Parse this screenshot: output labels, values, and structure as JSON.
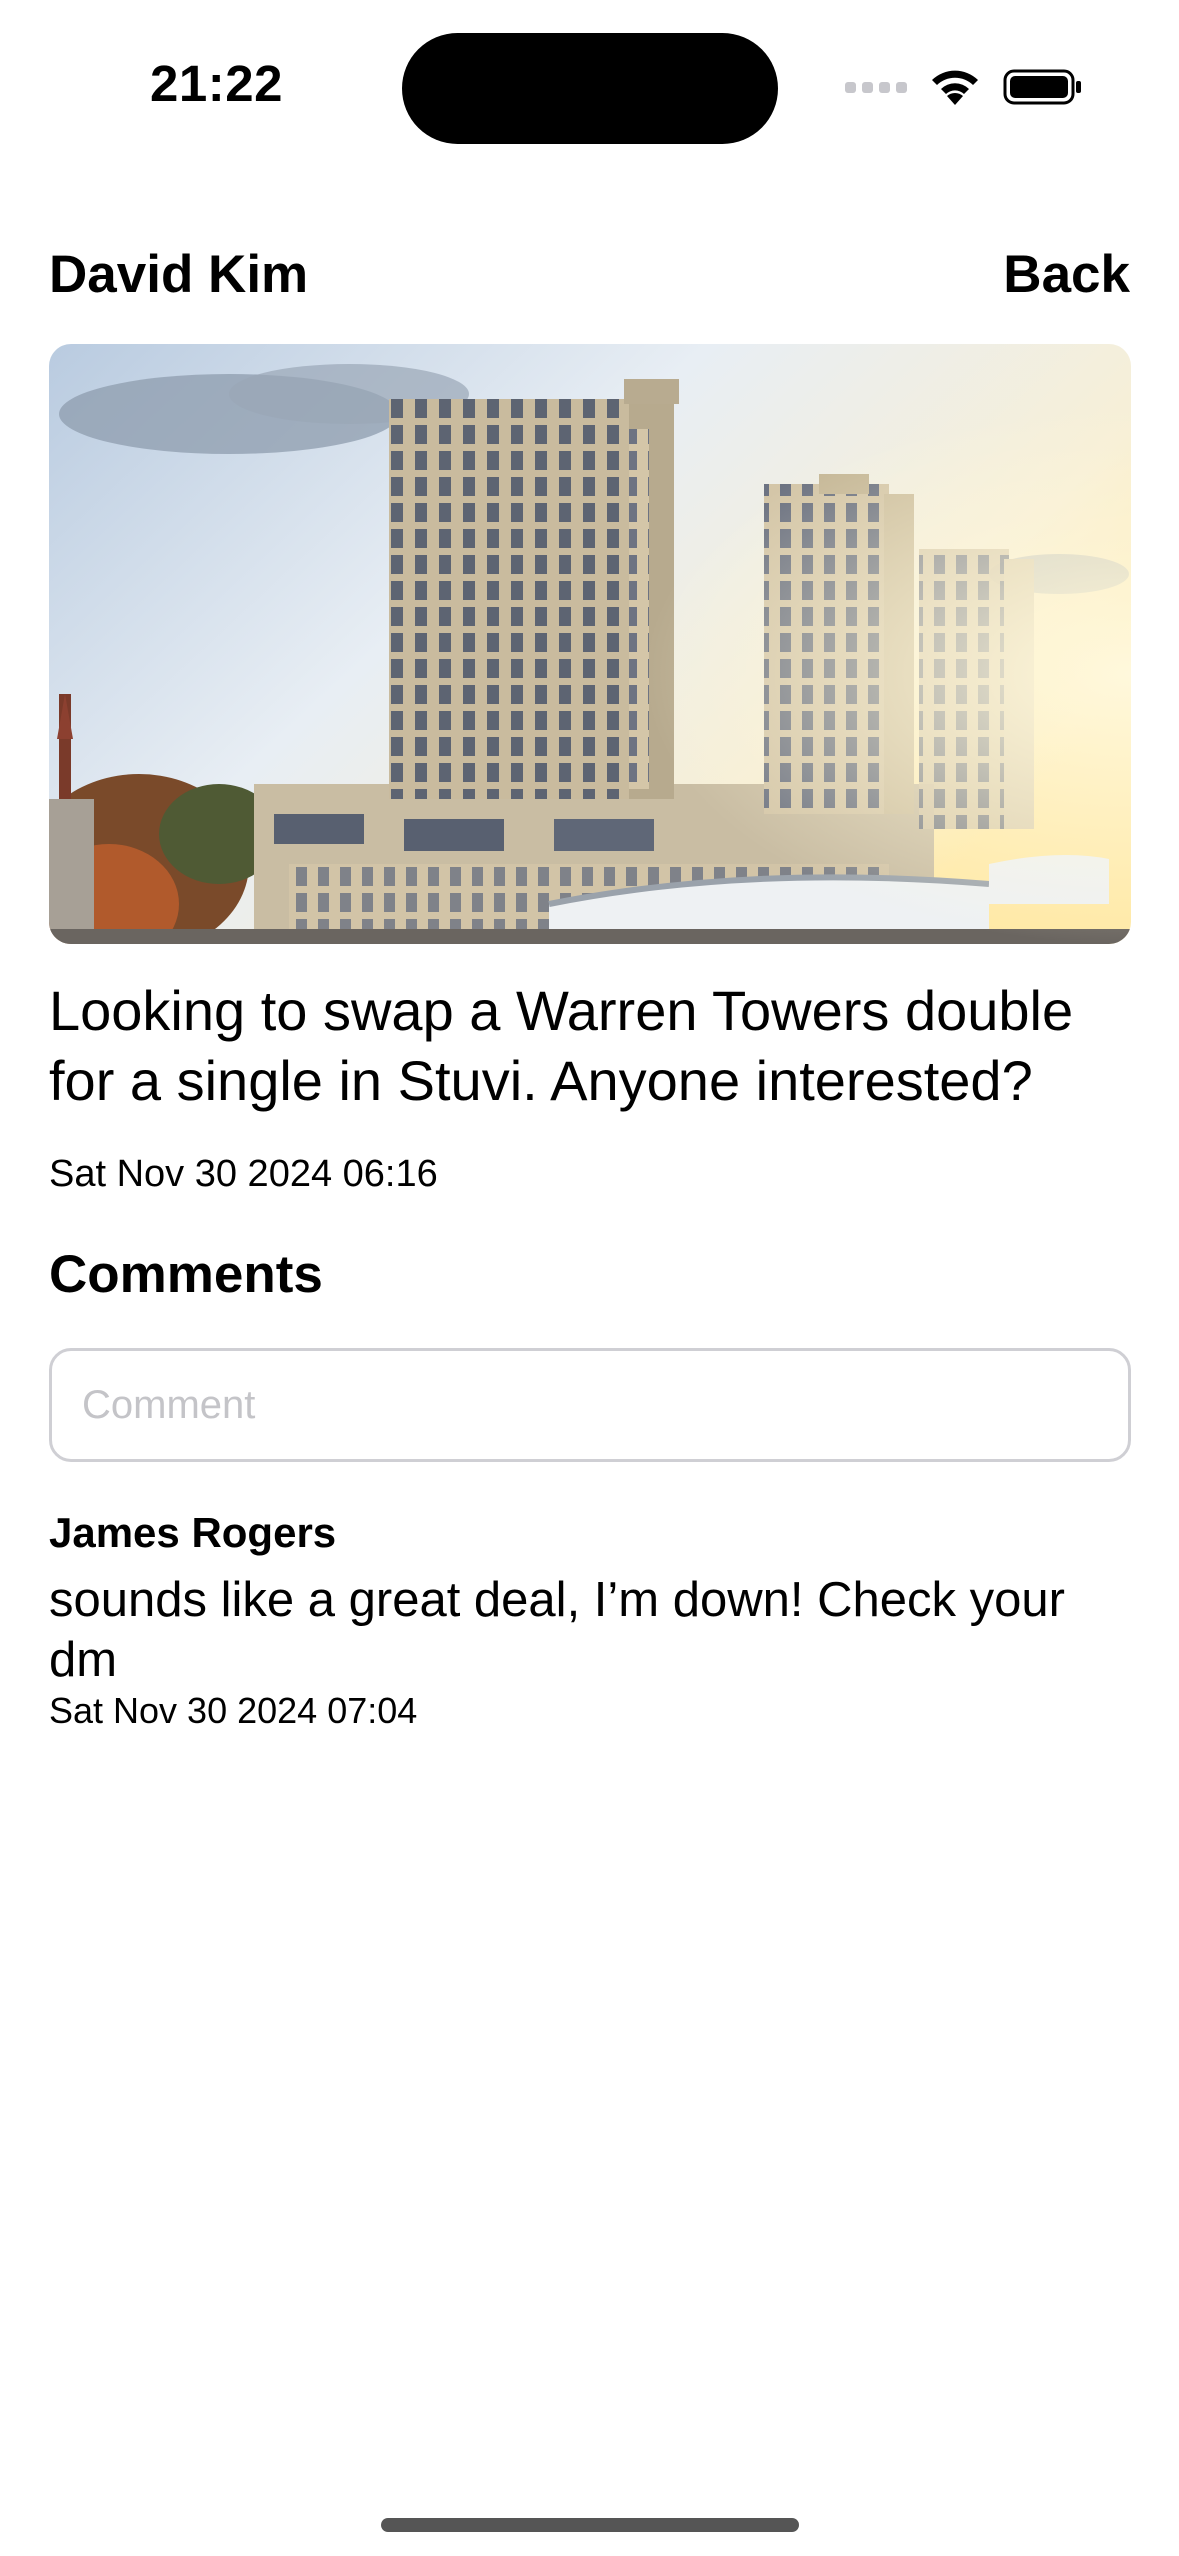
{
  "status_bar": {
    "time": "21:22",
    "icons": [
      "cellular-signal-icon",
      "wifi-icon",
      "battery-icon"
    ]
  },
  "nav": {
    "title": "David Kim",
    "back_label": "Back"
  },
  "post": {
    "image_description_icon": "photo-icon",
    "body": "Looking to swap a Warren Towers double for a single in Stuvi. Anyone interested?",
    "date": "Sat Nov 30 2024 06:16"
  },
  "comments": {
    "heading": "Comments",
    "input_placeholder": "Comment",
    "input_value": "",
    "items": [
      {
        "author": "James Rogers",
        "text": "sounds like a great deal, I’m down! Check your dm",
        "date": "Sat Nov 30 2024 07:04"
      }
    ]
  },
  "colors": {
    "background": "#ffffff",
    "text": "#000000",
    "input_border": "#cfcfd4",
    "placeholder": "#c4c4c8"
  }
}
